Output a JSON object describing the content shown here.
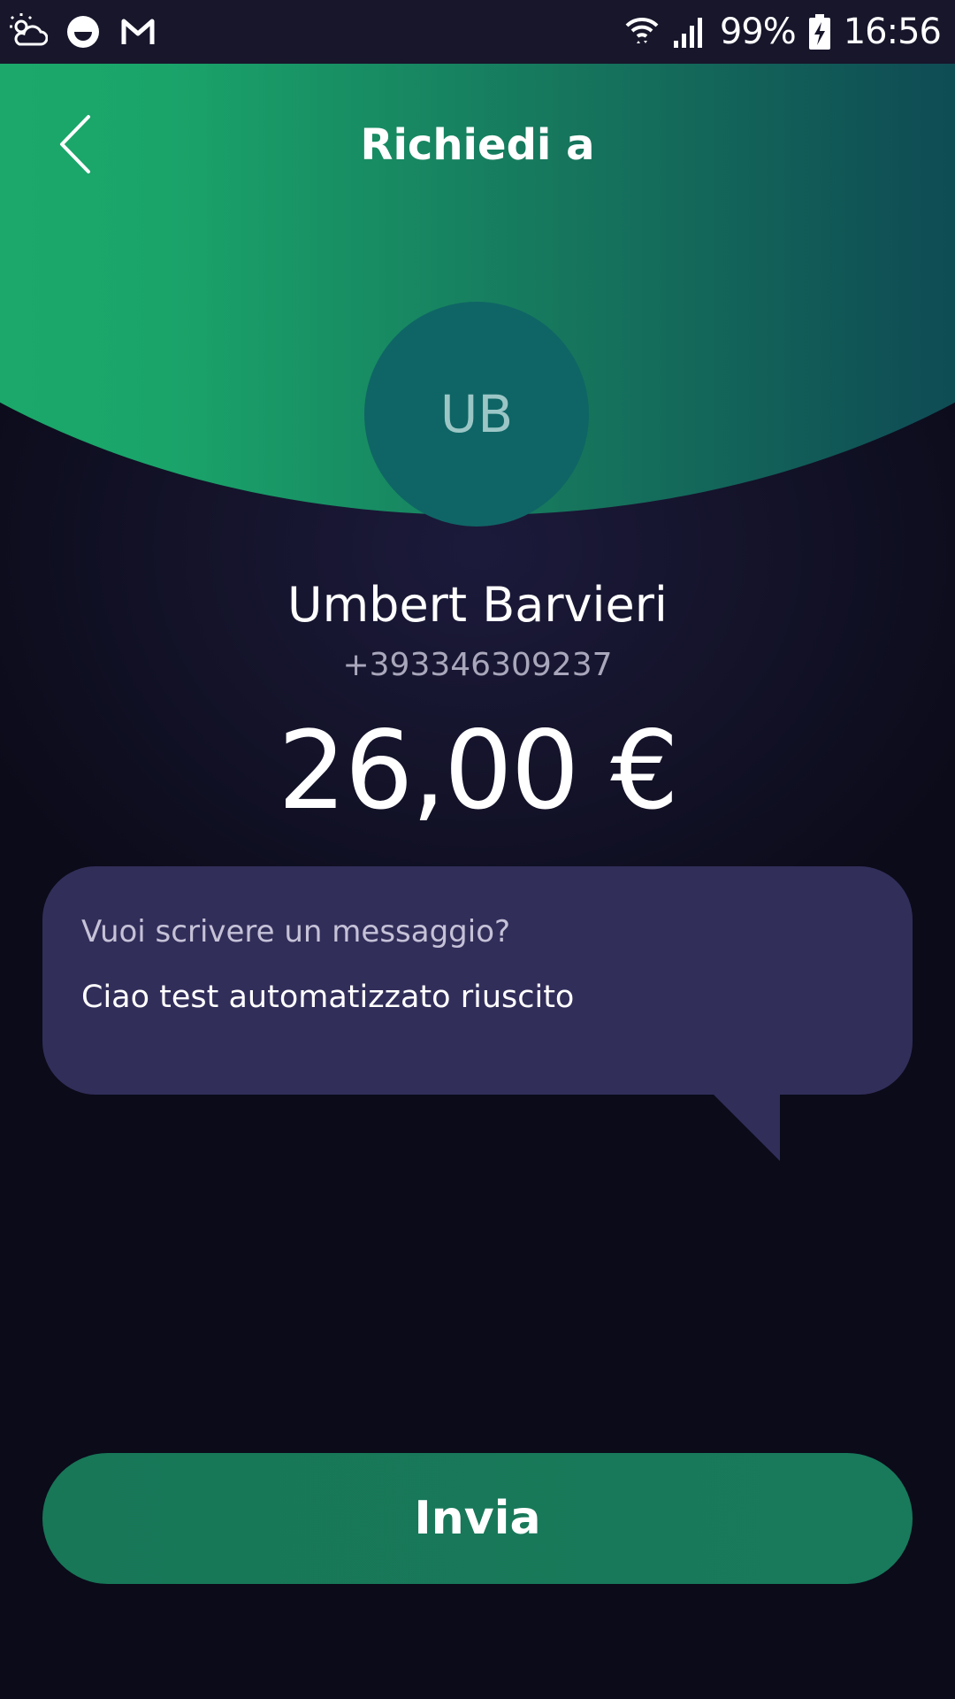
{
  "status_bar": {
    "battery": "99%",
    "time": "16:56",
    "icons": [
      "weather-icon",
      "face-app-icon",
      "gmail-icon",
      "wifi-icon",
      "signal-icon",
      "battery-charging-icon"
    ]
  },
  "header": {
    "title": "Richiedi a",
    "back_icon": "chevron-left-icon",
    "gradient_colors": [
      "#1fb06b",
      "#0c3d4e"
    ]
  },
  "contact": {
    "initials": "UB",
    "name": "Umbert Barvieri",
    "phone": "+393346309237"
  },
  "amount": "26,00 €",
  "message": {
    "label": "Vuoi scrivere un messaggio?",
    "text": "Ciao test automatizzato riuscito"
  },
  "send_button": {
    "label": "Invia",
    "color": "#177757"
  }
}
